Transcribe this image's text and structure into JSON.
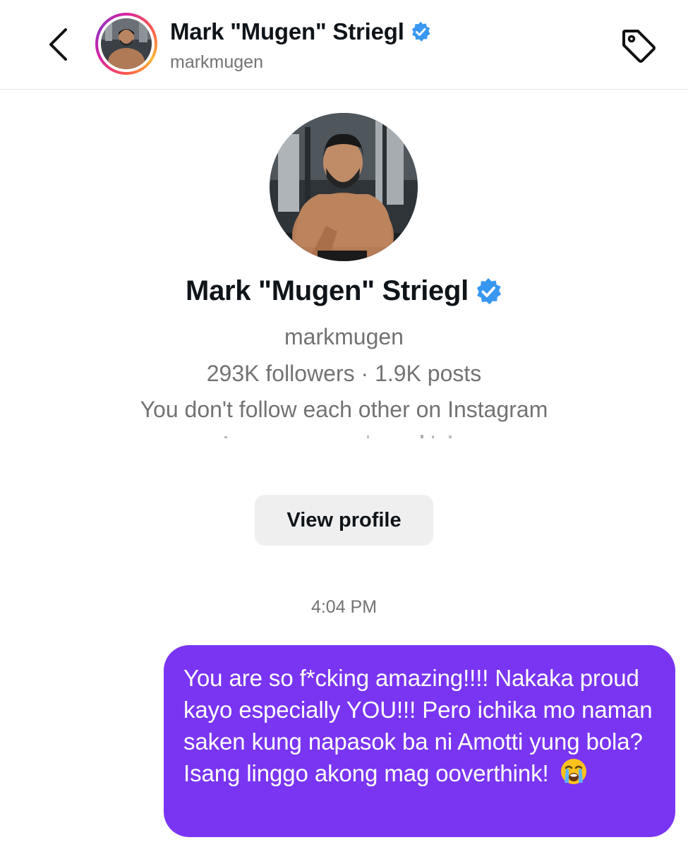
{
  "header": {
    "name": "Mark \"Mugen\" Striegl",
    "handle": "markmugen",
    "back_icon": "chevron-left-icon",
    "tag_icon": "tag-icon"
  },
  "profile": {
    "name": "Mark \"Mugen\" Striegl",
    "handle": "markmugen",
    "stats": "293K followers · 1.9K posts",
    "follow_status": "You don't follow each other on Instagram",
    "view_profile_label": "View profile"
  },
  "messages": {
    "timestamp": "4:04 PM",
    "items": [
      {
        "text": "You are so f*cking amazing!!!! Nakaka proud kayo especially YOU!!! Pero ichika mo naman saken kung napasok ba ni Amotti yung bola? Isang linggo akong mag ooverthink!",
        "emoji": "loudly-crying-face-icon"
      }
    ]
  },
  "colors": {
    "verified": "#3897f0",
    "bubble": "#7a35f2",
    "muted_text": "#737373",
    "button_bg": "#efefef"
  }
}
